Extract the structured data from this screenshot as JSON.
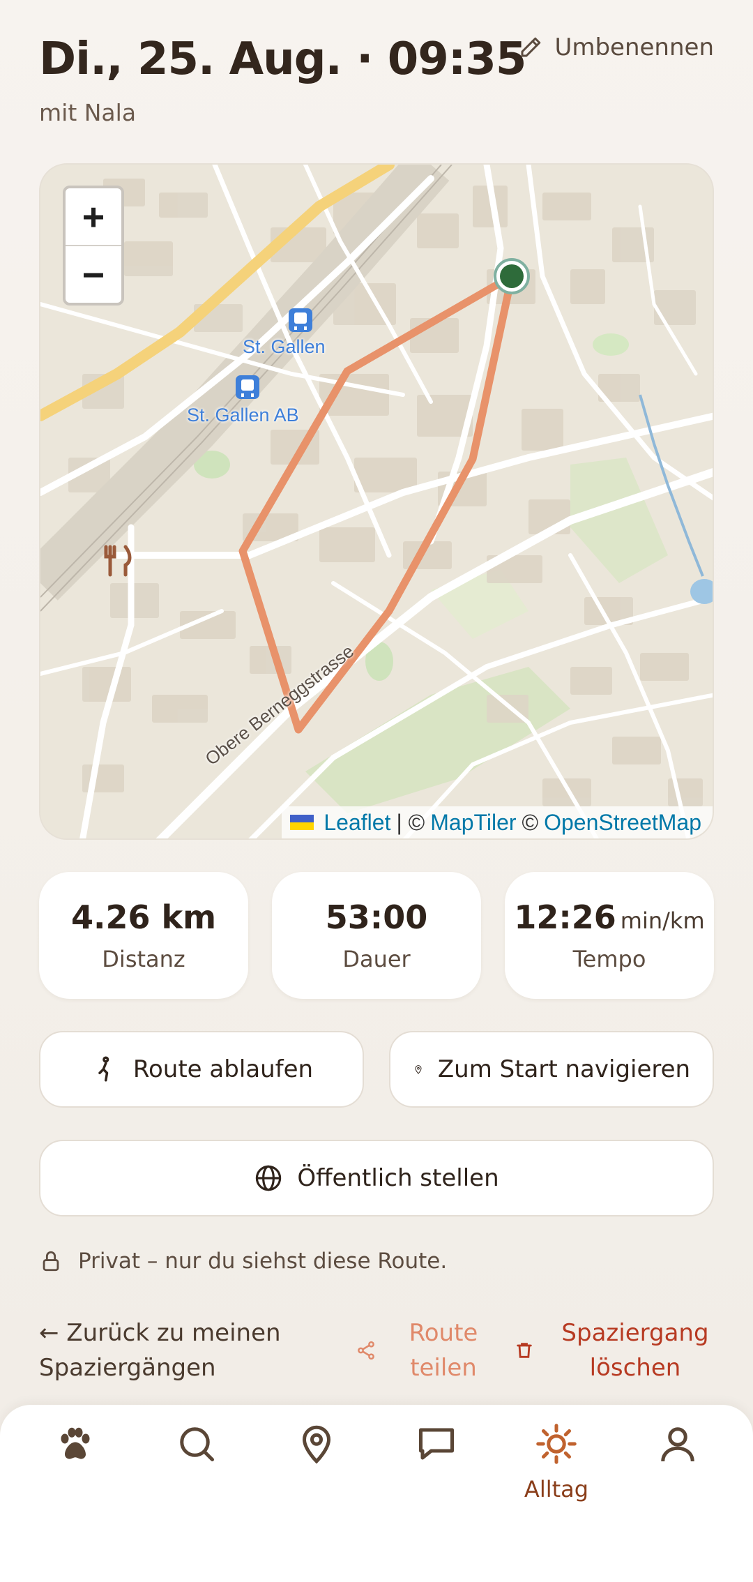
{
  "header": {
    "title": "Di., 25. Aug. · 09:35",
    "subtitle": "mit Nala",
    "rename_label": "Umbenennen"
  },
  "map": {
    "zoom_in": "+",
    "zoom_out": "−",
    "labels": {
      "station_1": "St. Gallen",
      "station_2": "St. Gallen AB",
      "street": "Obere Berneggstrasse"
    },
    "attribution": {
      "leaflet": "Leaflet",
      "sep": "| ©",
      "maptiler": "MapTiler",
      "copy": "©",
      "osm": "OpenStreetMap"
    },
    "route_color": "#e8926a",
    "start_marker_color": "#2e6b3a"
  },
  "stats": {
    "distance": {
      "value": "4.26 km",
      "label": "Distanz"
    },
    "duration": {
      "value": "53:00",
      "label": "Dauer"
    },
    "pace": {
      "value": "12:26",
      "unit": "min/km",
      "label": "Tempo"
    }
  },
  "actions": {
    "walk_route": "Route ablaufen",
    "navigate_start": "Zum Start navigieren",
    "make_public": "Öffentlich stellen",
    "privacy_note": "Privat – nur du siehst diese Route.",
    "back": "← Zurück zu meinen Spaziergängen",
    "share": "Route teilen",
    "delete": "Spaziergang löschen"
  },
  "nav": {
    "items": [
      {
        "icon": "paw-icon"
      },
      {
        "icon": "search-icon"
      },
      {
        "icon": "location-pin-icon"
      },
      {
        "icon": "chat-icon"
      },
      {
        "icon": "sun-icon",
        "label": "Alltag",
        "active": true
      },
      {
        "icon": "user-icon"
      }
    ]
  },
  "colors": {
    "accent": "#c0622e",
    "share": "#e0896a",
    "danger": "#b73a22"
  }
}
